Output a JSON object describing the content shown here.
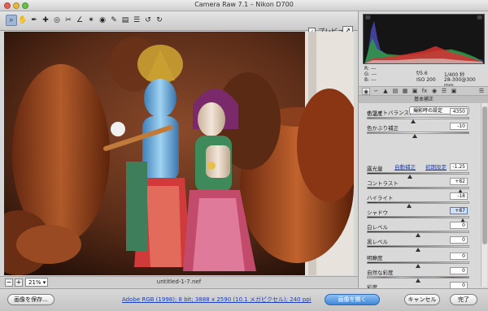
{
  "window": {
    "title": "Camera Raw 7.1  –  Nikon D700"
  },
  "toolbar": {
    "tools": [
      {
        "name": "zoom-tool-icon",
        "glyph": "⌕",
        "selected": true
      },
      {
        "name": "hand-tool-icon",
        "glyph": "✋"
      },
      {
        "name": "white-balance-tool-icon",
        "glyph": "✒"
      },
      {
        "name": "color-sampler-tool-icon",
        "glyph": "✚"
      },
      {
        "name": "targeted-adjustment-tool-icon",
        "glyph": "◎"
      },
      {
        "name": "crop-tool-icon",
        "glyph": "✂"
      },
      {
        "name": "straighten-tool-icon",
        "glyph": "∠"
      },
      {
        "name": "spot-removal-tool-icon",
        "glyph": "✶"
      },
      {
        "name": "red-eye-tool-icon",
        "glyph": "◉"
      },
      {
        "name": "adjustment-brush-tool-icon",
        "glyph": "✎"
      },
      {
        "name": "graduated-filter-tool-icon",
        "glyph": "▤"
      },
      {
        "name": "preferences-icon",
        "glyph": "☰"
      },
      {
        "name": "rotate-ccw-icon",
        "glyph": "↺"
      },
      {
        "name": "rotate-cw-icon",
        "glyph": "↻"
      }
    ],
    "preview_label": "プレビュー",
    "preview_check": "✓"
  },
  "canvas": {
    "zoom": "21%",
    "filename": "untitled-1-7.nef"
  },
  "info": {
    "r_label": "R:",
    "g_label": "G:",
    "b_label": "B:",
    "r_val": "---",
    "g_val": "---",
    "b_val": "---",
    "aperture": "f/5.6",
    "shutter": "1/400 秒",
    "iso": "ISO 200",
    "lens": "28-300@300 mm"
  },
  "panel": {
    "title": "基本補正",
    "wb_label": "ホワイトバランス：",
    "wb_value": "撮影時の設定",
    "auto_label": "自動補正",
    "default_label": "初期設定",
    "sliders": [
      {
        "label": "色温度",
        "value": "4350",
        "pos": 0.45,
        "track": "temp"
      },
      {
        "label": "色かぶり補正",
        "value": "-10",
        "pos": 0.47,
        "track": "tint"
      },
      {
        "label": "露光量",
        "value": "-1.25",
        "pos": 0.42,
        "track": "gray"
      },
      {
        "label": "コントラスト",
        "value": "+82",
        "pos": 0.91,
        "track": "gray"
      },
      {
        "label": "ハイライト",
        "value": "-18",
        "pos": 0.41,
        "track": "gray"
      },
      {
        "label": "シャドウ",
        "value": "+87",
        "pos": 0.94,
        "track": "gray",
        "active": true
      },
      {
        "label": "白レベル",
        "value": "0",
        "pos": 0.5,
        "track": "gray"
      },
      {
        "label": "黒レベル",
        "value": "0",
        "pos": 0.5,
        "track": "gray"
      },
      {
        "label": "明瞭度",
        "value": "0",
        "pos": 0.5,
        "track": "gray"
      },
      {
        "label": "自然な彩度",
        "value": "0",
        "pos": 0.5,
        "track": "sat"
      },
      {
        "label": "彩度",
        "value": "0",
        "pos": 0.5,
        "track": "sat"
      }
    ]
  },
  "footer": {
    "save_label": "画像を保存...",
    "workflow_label": "Adobe RGB (1998); 8 bit; 3888 x 2590 (10.1 メガピクセル); 240 ppi",
    "open_label": "画像を開く",
    "cancel_label": "キャンセル",
    "done_label": "完了"
  },
  "colors": {
    "accent": "#3f87d8",
    "link": "#1a3fb8"
  }
}
